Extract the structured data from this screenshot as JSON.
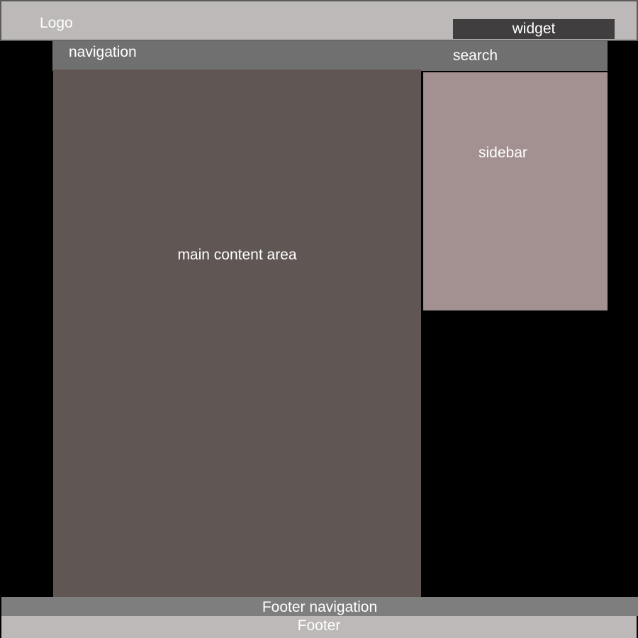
{
  "colors": {
    "page_background": "#000000",
    "header": "#bcb9b8",
    "widget": "#403e3f",
    "navigation": "#717070",
    "main_content": "#605755",
    "sidebar": "#a39191",
    "footer_navigation": "#7f7e7e",
    "footer": "#bcb9b8",
    "text": "#ffffff"
  },
  "header": {
    "logo": "Logo"
  },
  "widget": {
    "label": "widget"
  },
  "navigation": {
    "label": "navigation",
    "search": "search"
  },
  "main": {
    "label": "main content area"
  },
  "sidebar": {
    "label": "sidebar"
  },
  "footer_navigation": {
    "label": "Footer navigation"
  },
  "footer": {
    "label": "Footer"
  }
}
